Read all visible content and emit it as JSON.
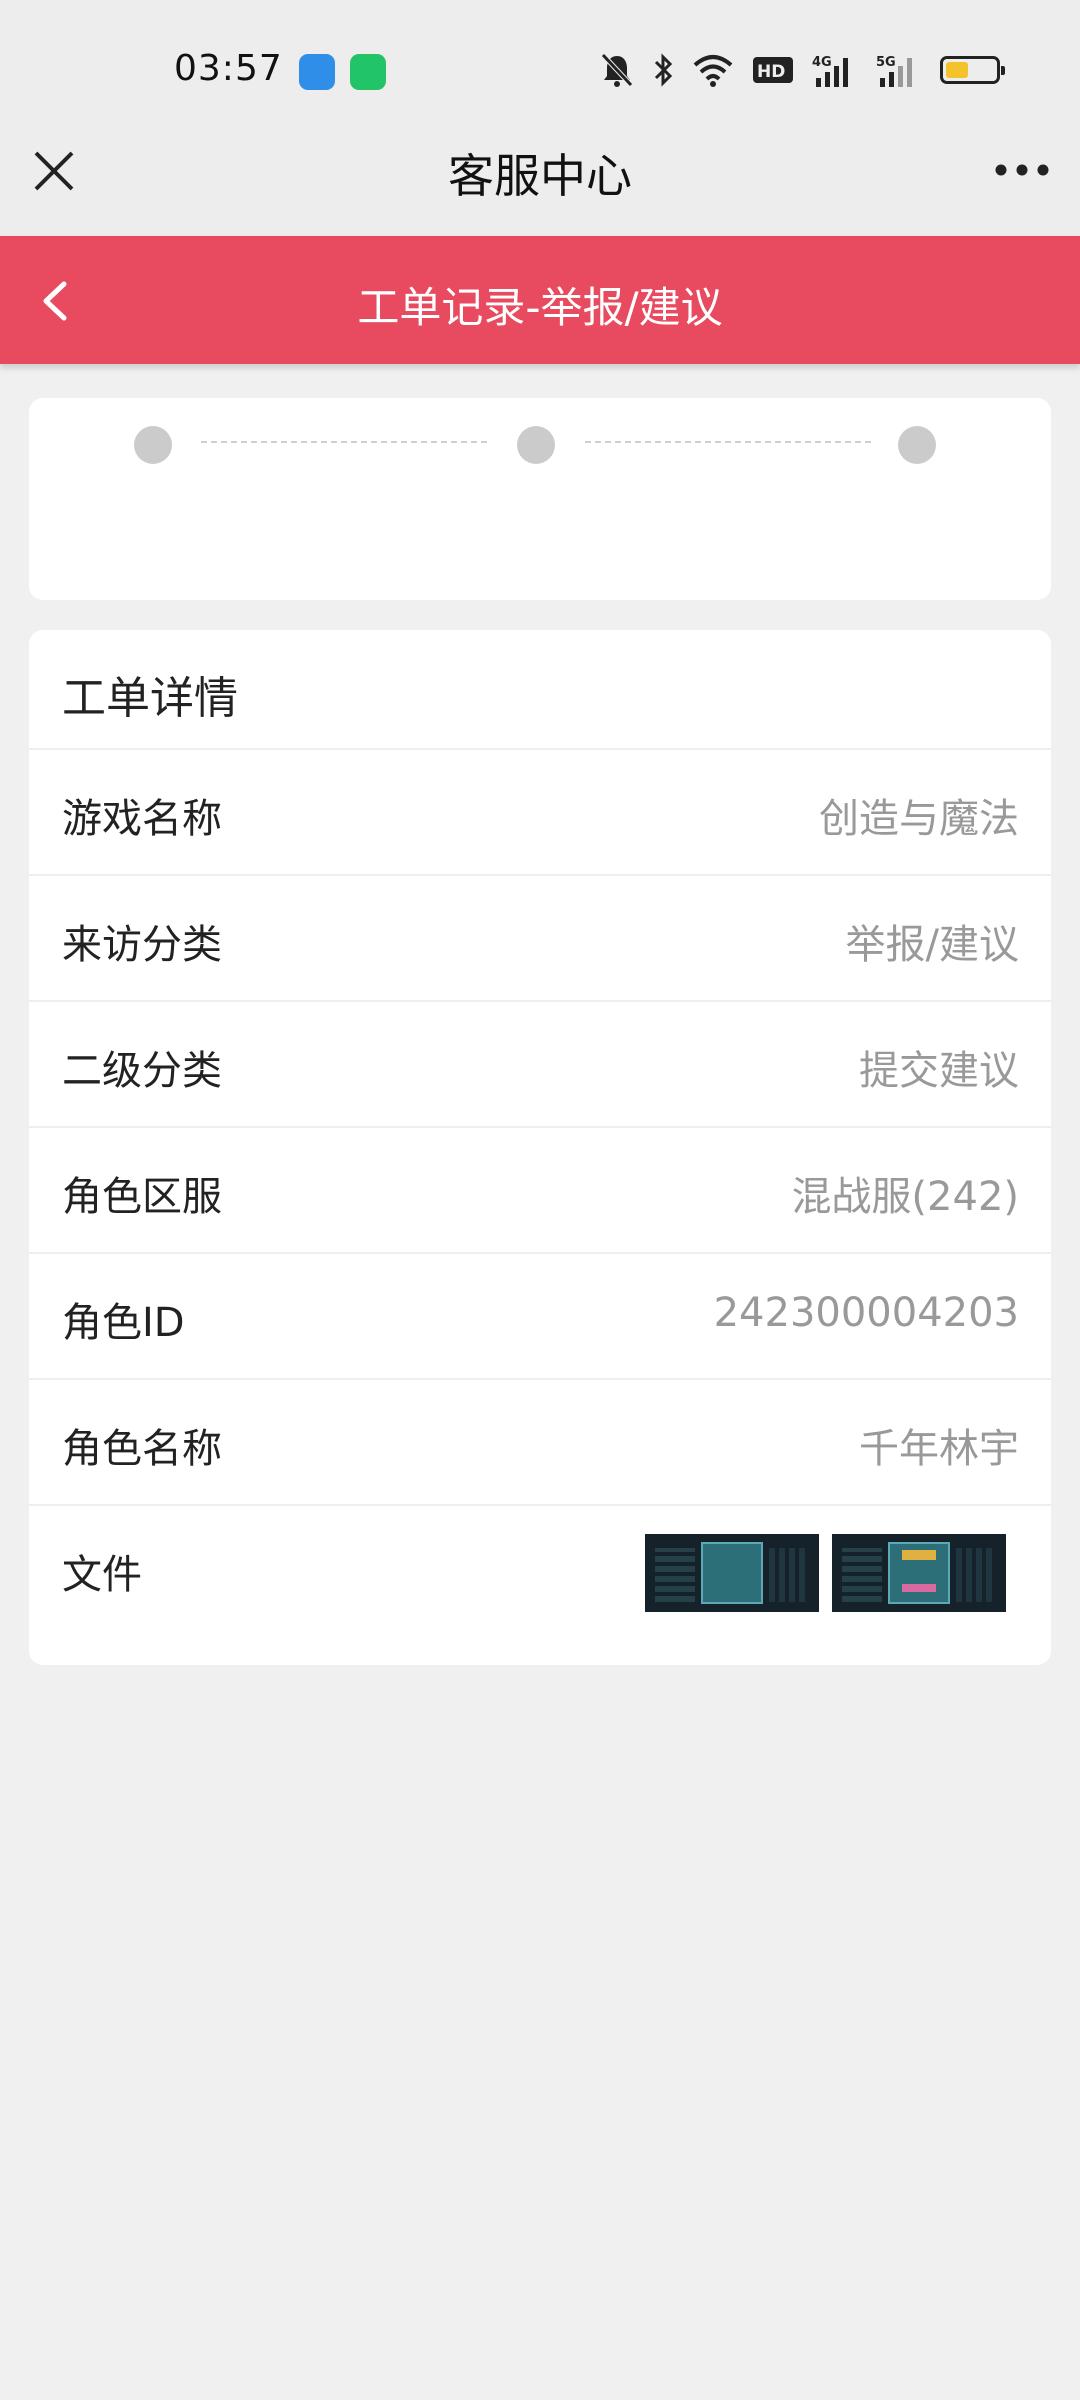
{
  "status_bar": {
    "time": "03:57",
    "apps": [
      "tp-link-app-icon",
      "green-app-icon"
    ],
    "icons": [
      "bell-muted-icon",
      "bluetooth-icon",
      "wifi-icon",
      "hd-icon",
      "signal-4g-icon",
      "signal-5g-icon",
      "battery-icon"
    ],
    "hd_label": "HD",
    "net1": "4G",
    "net2": "5G",
    "battery_level": 0.45
  },
  "nav": {
    "title": "客服中心"
  },
  "header": {
    "title": "工单记录-举报/建议",
    "accent_color": "#e84a5f"
  },
  "progress": {
    "steps": 3
  },
  "details": {
    "title": "工单详情",
    "rows": [
      {
        "label": "游戏名称",
        "value": "创造与魔法"
      },
      {
        "label": "来访分类",
        "value": "举报/建议"
      },
      {
        "label": "二级分类",
        "value": "提交建议"
      },
      {
        "label": "角色区服",
        "value": "混战服(242)"
      },
      {
        "label": "角色ID",
        "value": "242300004203"
      },
      {
        "label": "角色名称",
        "value": "千年林宇"
      }
    ],
    "files_label": "文件",
    "files": [
      "screenshot-1",
      "screenshot-2"
    ]
  }
}
